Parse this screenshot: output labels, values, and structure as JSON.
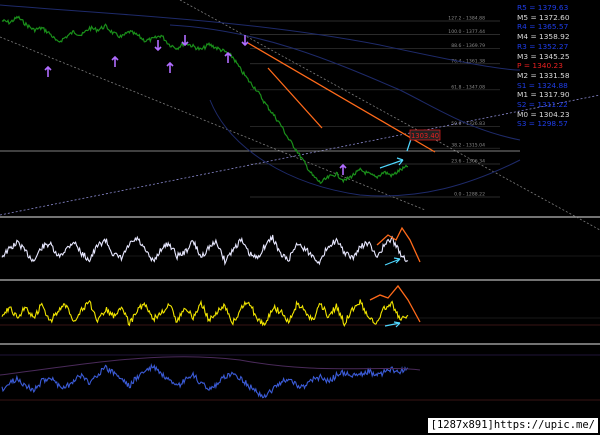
{
  "pivots": [
    {
      "label": "R5",
      "value": "1379.63",
      "color": "#1f3de8"
    },
    {
      "label": "M5",
      "value": "1372.60",
      "color": "#d9d9d9"
    },
    {
      "label": "R4",
      "value": "1365.57",
      "color": "#1f3de8"
    },
    {
      "label": "M4",
      "value": "1358.92",
      "color": "#d9d9d9"
    },
    {
      "label": "R3",
      "value": "1352.27",
      "color": "#1f3de8"
    },
    {
      "label": "M3",
      "value": "1345.25",
      "color": "#d9d9d9"
    },
    {
      "label": "P",
      "value": "1340.23",
      "color": "#e82020"
    },
    {
      "label": "M2",
      "value": "1331.58",
      "color": "#d9d9d9"
    },
    {
      "label": "S1",
      "value": "1324.88",
      "color": "#1f3de8"
    },
    {
      "label": "M1",
      "value": "1317.90",
      "color": "#d9d9d9"
    },
    {
      "label": "S2",
      "value": "1311.22",
      "color": "#1f3de8"
    },
    {
      "label": "M0",
      "value": "1304.23",
      "color": "#d9d9d9"
    },
    {
      "label": "S3",
      "value": "1298.57",
      "color": "#1f3de8"
    }
  ],
  "watermark": "[1287x891]https://upic.me/",
  "chart_data": [
    {
      "type": "line",
      "name": "price",
      "line_color": "#1a8f1a",
      "price_box": "1303.40",
      "fib_labels": [
        "127.2 - 1384.88",
        "100.0 - 1377.44",
        "88.6 - 1369.79",
        "76.4 - 1361.38",
        "61.8 - 1347.08",
        "50.0 - 1326.83",
        "38.2 - 1315.04",
        "23.6 - 1306.34",
        "0.0 - 1288.22"
      ],
      "ylim": [
        1280,
        1392
      ],
      "values": [
        1385,
        1384,
        1387,
        1383,
        1380,
        1381,
        1378,
        1373,
        1376,
        1379,
        1377,
        1381,
        1380,
        1382,
        1378,
        1376,
        1379,
        1377,
        1374,
        1375,
        1377,
        1372,
        1370,
        1373,
        1371,
        1369,
        1372,
        1370,
        1368,
        1365,
        1358,
        1352,
        1347,
        1340,
        1334,
        1328,
        1320,
        1314,
        1307,
        1300,
        1296,
        1299,
        1301,
        1297,
        1300,
        1303,
        1301,
        1299,
        1302,
        1300,
        1303,
        1305
      ]
    },
    {
      "type": "line",
      "name": "oscillator-white",
      "line_color": "#e8e8ff",
      "ylim": [
        -100,
        100
      ],
      "values": [
        -20,
        10,
        35,
        -5,
        -40,
        15,
        30,
        -25,
        5,
        40,
        -10,
        -35,
        20,
        45,
        -15,
        -30,
        25,
        50,
        0,
        -45,
        10,
        30,
        -20,
        -5,
        40,
        -25,
        15,
        35,
        -40,
        5,
        45,
        -10,
        -30,
        20,
        55,
        -15,
        -35,
        30,
        10,
        -20,
        -45,
        25,
        40,
        -5,
        -30,
        15,
        35,
        -25,
        20,
        50,
        -10,
        -40
      ]
    },
    {
      "type": "line",
      "name": "oscillator-yellow",
      "line_color": "#f2e600",
      "ylim": [
        -100,
        100
      ],
      "values": [
        0,
        25,
        -15,
        30,
        -20,
        40,
        -30,
        10,
        35,
        -25,
        15,
        45,
        -35,
        20,
        -10,
        30,
        -40,
        15,
        40,
        -20,
        5,
        35,
        -30,
        25,
        -15,
        45,
        -25,
        10,
        30,
        -35,
        20,
        50,
        -20,
        -40,
        25,
        10,
        -30,
        35,
        15,
        -25,
        40,
        -10,
        30,
        -35,
        20,
        45,
        -15,
        -30,
        25,
        40,
        -20,
        -5
      ]
    },
    {
      "type": "line",
      "name": "oscillator-blue",
      "line_color": "#3b5bd6",
      "ylim": [
        -100,
        100
      ],
      "values": [
        -30,
        -10,
        5,
        -20,
        -35,
        -5,
        10,
        -15,
        -25,
        0,
        15,
        -10,
        20,
        40,
        25,
        5,
        -20,
        10,
        30,
        45,
        20,
        -5,
        -25,
        0,
        15,
        -10,
        -30,
        -15,
        10,
        25,
        5,
        -20,
        -40,
        -55,
        -30,
        -10,
        5,
        -15,
        -25,
        0,
        10,
        -5,
        15,
        25,
        10,
        20,
        30,
        15,
        25,
        35,
        30,
        40
      ]
    }
  ]
}
